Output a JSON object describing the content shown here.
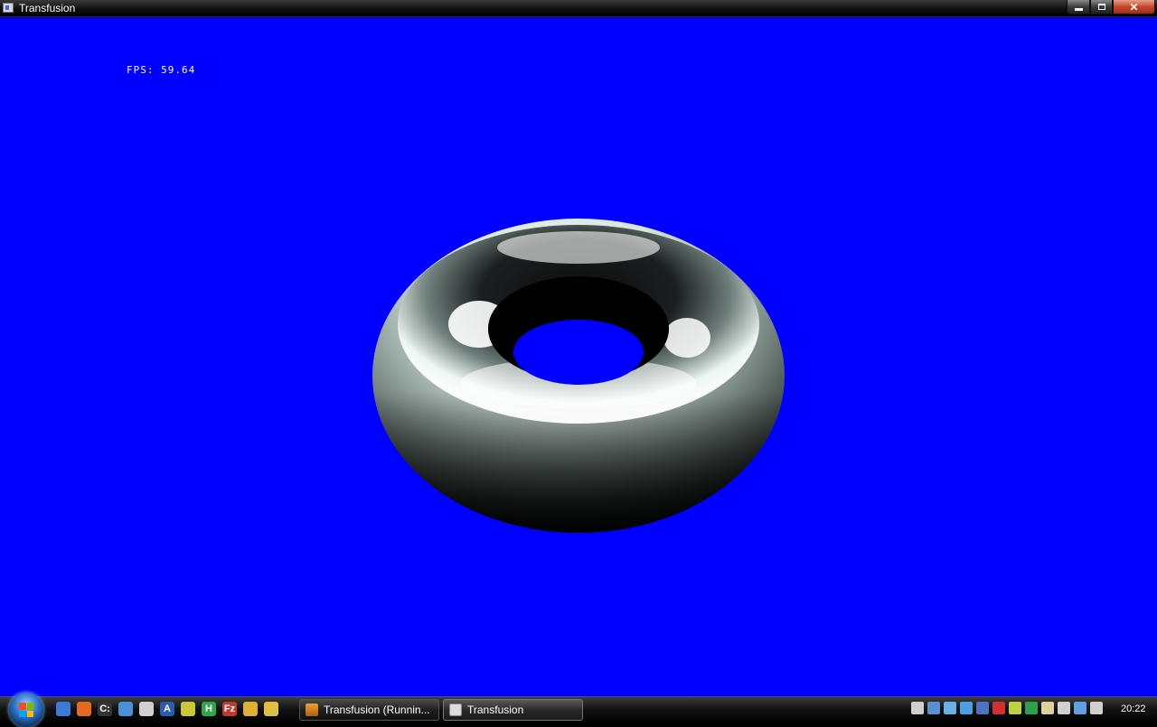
{
  "window": {
    "title": "Transfusion",
    "controls": {
      "minimize": "minimize",
      "maximize": "restore",
      "close": "✕"
    }
  },
  "viewport": {
    "background": "#0000fe",
    "fps_text": "FPS: 59.64",
    "object": "shaded-torus"
  },
  "taskbar": {
    "start_icon": "windows-start-orb",
    "quick_launch": [
      {
        "name": "show-desktop-icon",
        "color": "#3b7ad8",
        "glyph": ""
      },
      {
        "name": "firefox-icon",
        "color": "#e66a1c",
        "glyph": ""
      },
      {
        "name": "command-prompt-icon",
        "color": "#333333",
        "glyph": "C:"
      },
      {
        "name": "network-icon",
        "color": "#4a90d9",
        "glyph": ""
      },
      {
        "name": "shield-icon",
        "color": "#d0d0d0",
        "glyph": ""
      },
      {
        "name": "font-a-icon",
        "color": "#2a5db0",
        "glyph": "A"
      },
      {
        "name": "media-icon",
        "color": "#c8c83a",
        "glyph": ""
      },
      {
        "name": "h-app-icon",
        "color": "#2aa84a",
        "glyph": "H"
      },
      {
        "name": "filezilla-icon",
        "color": "#c0392b",
        "glyph": "Fz"
      },
      {
        "name": "chrome-icon",
        "color": "#e0b030",
        "glyph": ""
      },
      {
        "name": "player-icon",
        "color": "#e0c040",
        "glyph": ""
      }
    ],
    "tasks": [
      {
        "label": "Transfusion (Runnin...",
        "icon": "java-icon",
        "active": false
      },
      {
        "label": "Transfusion",
        "icon": "app-window-icon",
        "active": true
      }
    ],
    "tray_icons": [
      {
        "name": "shield-tray-icon",
        "color": "#cfcfcf"
      },
      {
        "name": "network-tray-icon",
        "color": "#5a8fd0"
      },
      {
        "name": "display-tray-icon",
        "color": "#6ab0e0"
      },
      {
        "name": "messenger-tray-icon",
        "color": "#4aa0e0"
      },
      {
        "name": "lightning-tray-icon",
        "color": "#5070c0"
      },
      {
        "name": "antivirus-tray-icon",
        "color": "#d03030"
      },
      {
        "name": "arrow-tray-icon",
        "color": "#c0d040"
      },
      {
        "name": "graph-tray-icon",
        "color": "#30a050"
      },
      {
        "name": "document-tray-icon",
        "color": "#e0d0a0"
      },
      {
        "name": "phone-tray-icon",
        "color": "#d0d0d0"
      },
      {
        "name": "network-status-icon",
        "color": "#60a0e0"
      },
      {
        "name": "volume-icon",
        "color": "#d0d0d0"
      }
    ],
    "clock": "20:22"
  }
}
